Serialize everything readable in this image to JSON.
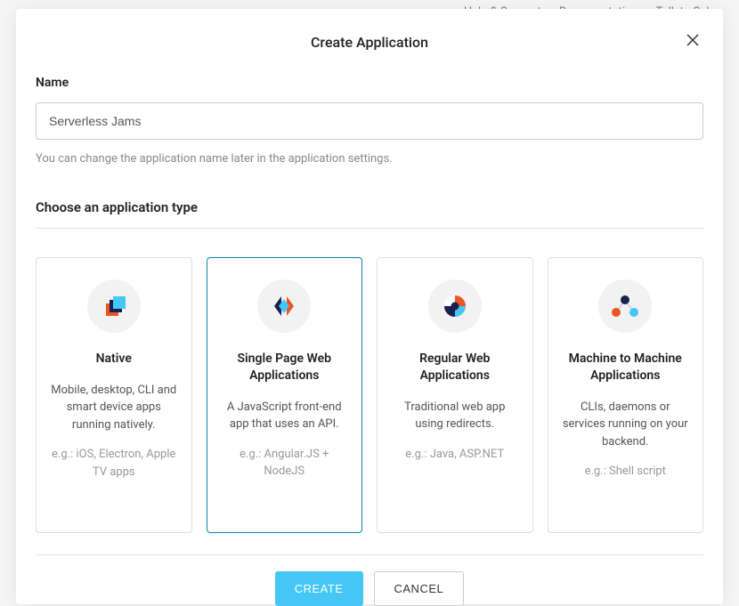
{
  "nav": {
    "help": "Help & Support",
    "docs": "Documentation",
    "sales": "Talk to Sales"
  },
  "modal": {
    "title": "Create Application",
    "name_label": "Name",
    "name_value": "Serverless Jams",
    "name_helper": "You can change the application name later in the application settings.",
    "type_label": "Choose an application type",
    "types": [
      {
        "title": "Native",
        "desc": "Mobile, desktop, CLI and smart device apps running natively.",
        "eg": "e.g.: iOS, Electron, Apple TV apps"
      },
      {
        "title": "Single Page Web Applications",
        "desc": "A JavaScript front-end app that uses an API.",
        "eg": "e.g.: Angular.JS + NodeJS"
      },
      {
        "title": "Regular Web Applications",
        "desc": "Traditional web app using redirects.",
        "eg": "e.g.: Java, ASP.NET"
      },
      {
        "title": "Machine to Machine Applications",
        "desc": "CLIs, daemons or services running on your backend.",
        "eg": "e.g.: Shell script"
      }
    ],
    "create_btn": "CREATE",
    "cancel_btn": "CANCEL"
  }
}
